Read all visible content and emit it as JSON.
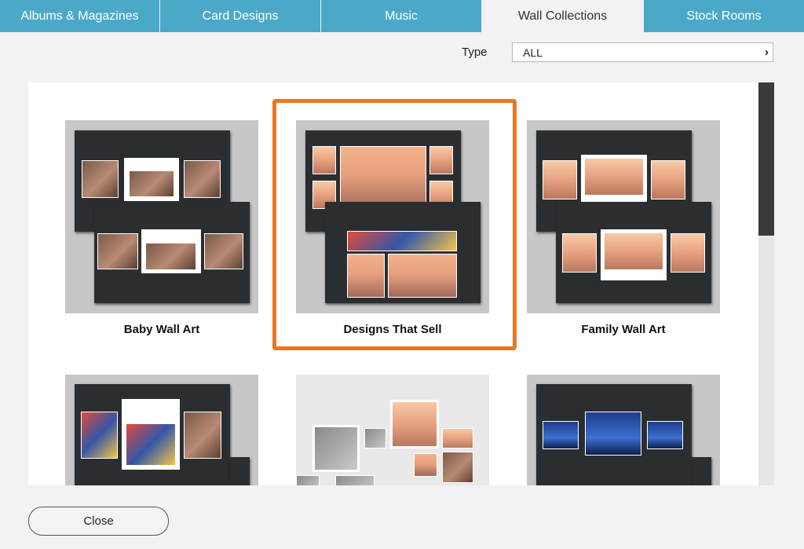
{
  "tabs": [
    {
      "label": "Albums & Magazines",
      "active": false
    },
    {
      "label": "Card Designs",
      "active": false
    },
    {
      "label": "Music",
      "active": false
    },
    {
      "label": "Wall Collections",
      "active": true
    },
    {
      "label": "Stock Rooms",
      "active": false
    }
  ],
  "filter": {
    "label": "Type",
    "value": "ALL",
    "chevron": "›"
  },
  "collections": [
    {
      "title": "Baby Wall Art",
      "selected": false
    },
    {
      "title": "Designs That Sell",
      "selected": true
    },
    {
      "title": "Family Wall Art",
      "selected": false
    },
    {
      "title": "",
      "selected": false
    },
    {
      "title": "",
      "selected": false
    },
    {
      "title": "",
      "selected": false
    }
  ],
  "footer": {
    "close_label": "Close"
  },
  "colors": {
    "tab_bar": "#4ba9c8",
    "selection": "#e87722",
    "board": "#2b2e31"
  }
}
